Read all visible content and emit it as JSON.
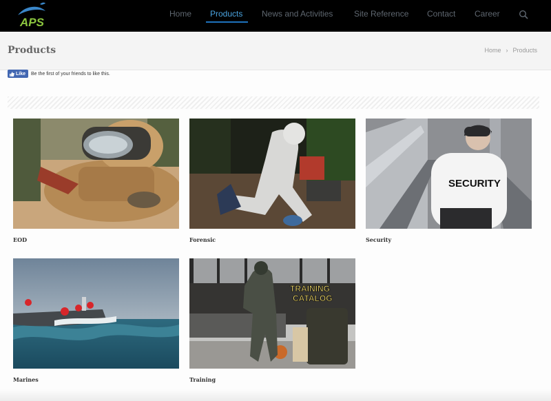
{
  "brand": {
    "logo_text": "APS",
    "accent": "#1e73be",
    "logo_green": "#8cc63f"
  },
  "nav": {
    "items": [
      {
        "label": "Home"
      },
      {
        "label": "Products",
        "active": true
      },
      {
        "label": "News and Activities"
      },
      {
        "label": "Site Reference"
      },
      {
        "label": "Contact"
      },
      {
        "label": "Career"
      }
    ],
    "search_icon": "search-icon"
  },
  "header": {
    "title": "Products",
    "breadcrumb": {
      "home": "Home",
      "separator": "›",
      "current": "Products"
    }
  },
  "facebook": {
    "button_label": "Like",
    "text": "Be the first of your friends to like this."
  },
  "products": [
    {
      "label": "EOD",
      "image": "eod-image"
    },
    {
      "label": "Forensic",
      "image": "forensic-image"
    },
    {
      "label": "Security",
      "image": "security-image"
    },
    {
      "label": "Marines",
      "image": "marines-image"
    },
    {
      "label": "Training",
      "image": "training-image",
      "overlay": "TRAINING\nCATALOG"
    }
  ]
}
